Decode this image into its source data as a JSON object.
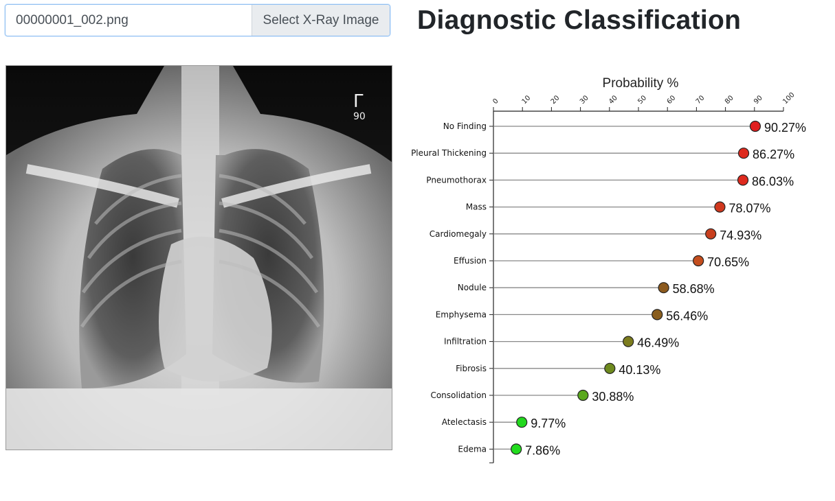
{
  "file_input": {
    "filename": "00000001_002.png",
    "button_label": "Select X-Ray Image"
  },
  "page_title": "Diagnostic Classification",
  "xray": {
    "marker_text": "Γ",
    "marker_sub": "90"
  },
  "chart_data": {
    "type": "lollipop",
    "xlabel": "Probability %",
    "xlim": [
      0,
      100
    ],
    "ticks": [
      0,
      10,
      20,
      30,
      40,
      50,
      60,
      70,
      80,
      90,
      100
    ],
    "categories": [
      "No Finding",
      "Pleural Thickening",
      "Pneumothorax",
      "Mass",
      "Cardiomegaly",
      "Effusion",
      "Nodule",
      "Emphysema",
      "Infiltration",
      "Fibrosis",
      "Consolidation",
      "Atelectasis",
      "Edema"
    ],
    "values": [
      90.27,
      86.27,
      86.03,
      78.07,
      74.93,
      70.65,
      58.68,
      56.46,
      46.49,
      40.13,
      30.88,
      9.77,
      7.86
    ],
    "value_labels": [
      "90.27%",
      "86.27%",
      "86.03%",
      "78.07%",
      "74.93%",
      "70.65%",
      "58.68%",
      "56.46%",
      "46.49%",
      "40.13%",
      "30.88%",
      "9.77%",
      "7.86%"
    ],
    "colors": [
      "#e01e1e",
      "#de2a1e",
      "#de2a1e",
      "#d0381e",
      "#c83f1e",
      "#c44e1e",
      "#8c5a1e",
      "#8a5e1e",
      "#7c7c1e",
      "#6e8a1e",
      "#5aa81e",
      "#22d81e",
      "#22dc1e"
    ]
  }
}
